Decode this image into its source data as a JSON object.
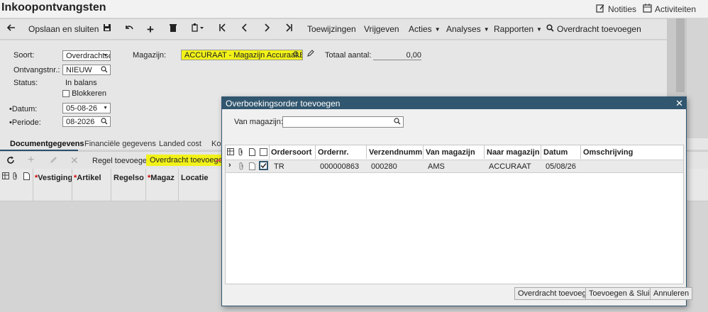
{
  "window": {
    "title": "Inkoopontvangsten",
    "notes_label": "Notities",
    "activities_label": "Activiteiten"
  },
  "toolbar": {
    "save_close": "Opslaan en sluiten",
    "assignments": "Toewijzingen",
    "release": "Vrijgeven",
    "actions": "Acties",
    "analyses": "Analyses",
    "reports": "Rapporten",
    "add_transfer": "Overdracht toevoegen"
  },
  "form": {
    "type_label": "Soort:",
    "type_value": "Overdrachtsc",
    "receipt_no_label": "Ontvangstnr.:",
    "receipt_no_value": "NIEUW",
    "status_label": "Status:",
    "status_value": "In balans",
    "block_label": "Blokkeren",
    "date_label": "Datum:",
    "date_value": "05-08-26",
    "period_label": "Periode:",
    "period_value": "08-2026",
    "warehouse_label": "Magazijn:",
    "warehouse_value": "ACCURAAT - Magazijn Accuraat BV",
    "total_qty_label": "Totaal aantal:",
    "total_qty_value": "0,00"
  },
  "tabs": [
    "Documentgegevens",
    "Financiële gegevens",
    "Landed cost",
    "Kor"
  ],
  "lines_toolbar": {
    "add_line": "Regel toevoegen",
    "add_transfer": "Overdracht toevoegen"
  },
  "grid_headers": {
    "branch": "Vestiging",
    "item": "Artikel",
    "line": "Regelso",
    "warehouse": "Magaz",
    "location": "Locatie"
  },
  "modal": {
    "title": "Overboekingsorder toevoegen",
    "from_warehouse_label": "Van magazijn:",
    "from_warehouse_value": "",
    "headers": {
      "order_type": "Ordersoort",
      "order_no": "Ordernr.",
      "shipment_no": "Verzendnumme",
      "from_wh": "Van magazijn",
      "to_wh": "Naar magazijn",
      "date": "Datum",
      "description": "Omschrijving"
    },
    "rows": [
      {
        "order_type": "TR",
        "order_no": "000000863",
        "shipment_no": "000280",
        "from_wh": "AMS",
        "to_wh": "ACCURAAT",
        "date": "05/08/26",
        "description": "",
        "selected": true
      }
    ],
    "buttons": {
      "add_transfer": "Overdracht toevoegen",
      "add_close": "Toevoegen & Sluiten",
      "cancel": "Annuleren"
    }
  },
  "colors": {
    "highlight": "#f2f219",
    "modal_header": "#31566f",
    "annotation_arrow": "#e0525a"
  }
}
